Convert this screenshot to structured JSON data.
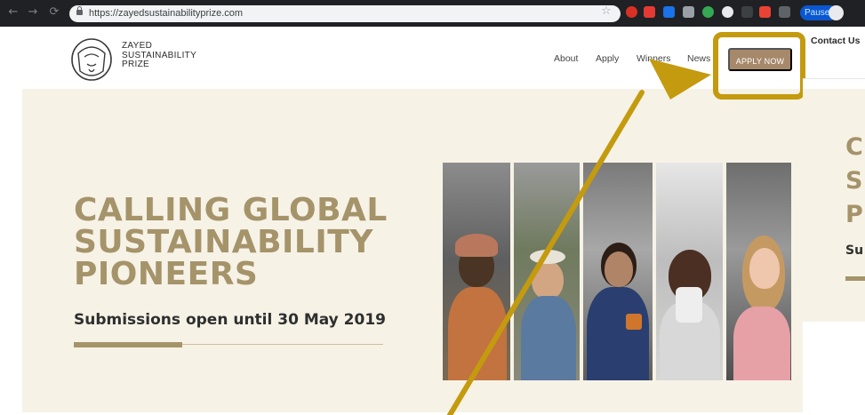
{
  "browser": {
    "url": "https://zayedsustainabilityprize.com",
    "status_badge": "Paused",
    "icons": [
      "back-icon",
      "forward-icon",
      "reload-icon",
      "lock-icon",
      "star-icon",
      "extension-icons",
      "avatar"
    ]
  },
  "header": {
    "logo_lines": [
      "ZAYED",
      "SUSTAINABILITY",
      "PRIZE"
    ],
    "nav": [
      "About",
      "Apply",
      "Winners",
      "News"
    ],
    "apply_button": "APPLY NOW",
    "contact": "Contact Us"
  },
  "hero": {
    "title_lines": [
      "CALLING GLOBAL",
      "SUSTAINABILITY",
      "PIONEERS"
    ],
    "subtitle": "Submissions open until 30 May 2019"
  },
  "side_panel": {
    "title_letters": [
      "C",
      "S",
      "P"
    ],
    "subtitle_fragment": "Su"
  },
  "colors": {
    "brand_gold": "#a5936a",
    "button": "#a6886a",
    "annotation": "#c49a0e",
    "hero_bg": "#f6f2e6"
  }
}
